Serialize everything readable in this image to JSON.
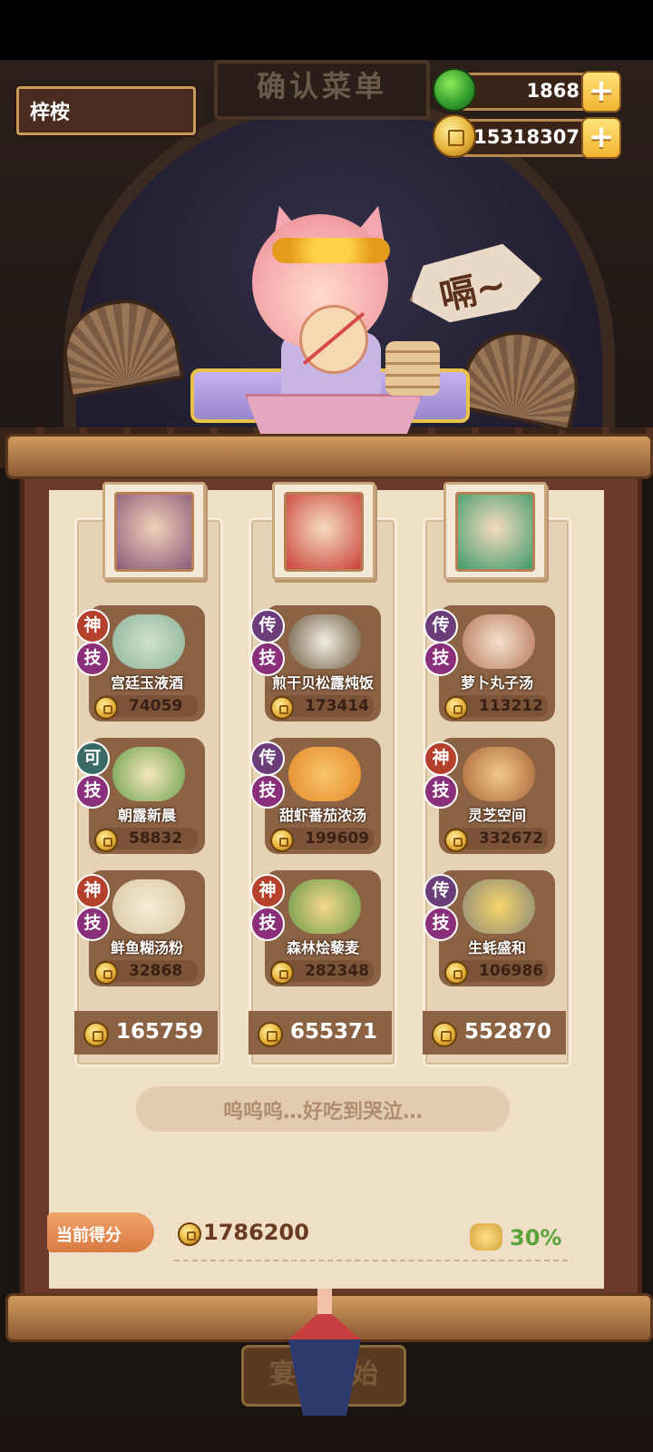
{
  "header": {
    "sign_title": "确认菜单",
    "player_name": "梓桉",
    "jade_amount": "1868",
    "gold_amount": "15318307",
    "add_label": "+"
  },
  "character": {
    "speech": "嗝~"
  },
  "columns": [
    {
      "dishes": [
        {
          "rank": "神",
          "skill": "技",
          "name": "宫廷玉液酒",
          "price": "74059"
        },
        {
          "rank": "可",
          "skill": "技",
          "name": "朝露新晨",
          "price": "58832"
        },
        {
          "rank": "神",
          "skill": "技",
          "name": "鲜鱼糊汤粉",
          "price": "32868"
        }
      ],
      "total": "165759"
    },
    {
      "dishes": [
        {
          "rank": "传",
          "skill": "技",
          "name": "煎干贝松露炖饭",
          "price": "173414"
        },
        {
          "rank": "传",
          "skill": "技",
          "name": "甜虾番茄浓汤",
          "price": "199609"
        },
        {
          "rank": "神",
          "skill": "技",
          "name": "森林烩藜麦",
          "price": "282348"
        }
      ],
      "total": "655371"
    },
    {
      "dishes": [
        {
          "rank": "传",
          "skill": "技",
          "name": "萝卜丸子汤",
          "price": "113212"
        },
        {
          "rank": "神",
          "skill": "技",
          "name": "灵芝空间",
          "price": "332672"
        },
        {
          "rank": "传",
          "skill": "技",
          "name": "生蚝盛和",
          "price": "106986"
        }
      ],
      "total": "552870"
    }
  ],
  "comment": "呜呜呜…好吃到哭泣…",
  "score": {
    "label": "当前得分",
    "value": "1786200",
    "bonus": "30%"
  },
  "start_button": "宴会开始",
  "colors": {
    "accent": "#d97a42",
    "bonus_green": "#5aa33a",
    "rank_shen": "#b5402c",
    "rank_chuan": "#6b3e7a",
    "rank_ke": "#3a6a66",
    "skill": "#8a2f7a"
  }
}
